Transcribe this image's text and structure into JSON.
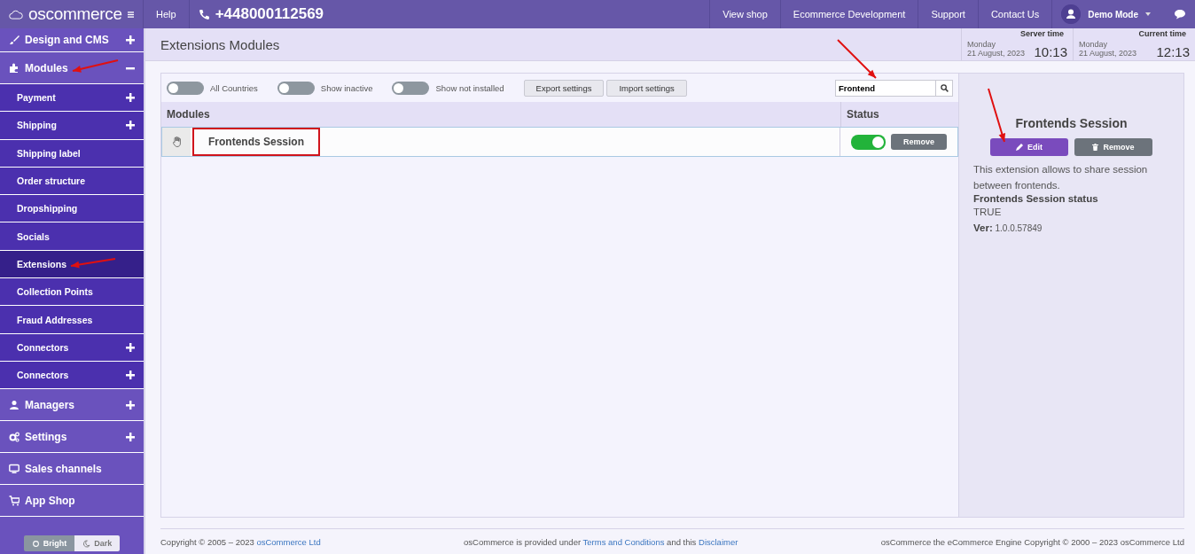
{
  "topbar": {
    "brand": "oscommerce",
    "help": "Help",
    "phone": "+448000112569",
    "links": [
      {
        "label": "View shop"
      },
      {
        "label": "Ecommerce Development"
      },
      {
        "label": "Support"
      },
      {
        "label": "Contact Us"
      }
    ],
    "user": "Demo Mode"
  },
  "sidebar": {
    "items": [
      {
        "kind": "section",
        "label": "Design and CMS",
        "expanded": false,
        "selected": false
      },
      {
        "kind": "section",
        "label": "Modules",
        "expanded": true,
        "selected": false
      },
      {
        "kind": "subitem",
        "label": "Payment",
        "expanded": false,
        "selected": false
      },
      {
        "kind": "subitem",
        "label": "Shipping",
        "expanded": false,
        "selected": false
      },
      {
        "kind": "subitem",
        "label": "Shipping label",
        "selected": false
      },
      {
        "kind": "subitem",
        "label": "Order structure",
        "selected": false
      },
      {
        "kind": "subitem",
        "label": "Dropshipping",
        "selected": false
      },
      {
        "kind": "subitem",
        "label": "Socials",
        "selected": false
      },
      {
        "kind": "subitem",
        "label": "Extensions",
        "selected": true
      },
      {
        "kind": "subitem",
        "label": "Collection Points",
        "selected": false
      },
      {
        "kind": "subitem",
        "label": "Fraud Addresses",
        "selected": false
      },
      {
        "kind": "subitem",
        "label": "Connectors",
        "expanded": false,
        "selected": false
      },
      {
        "kind": "subitem",
        "label": "Connectors",
        "expanded": false,
        "selected": false
      },
      {
        "kind": "section",
        "label": "Managers",
        "expanded": false,
        "selected": false
      },
      {
        "kind": "section",
        "label": "Settings",
        "expanded": false,
        "selected": false
      },
      {
        "kind": "section",
        "label": "Sales channels",
        "selected": false
      },
      {
        "kind": "section",
        "label": "App Shop",
        "selected": false
      }
    ],
    "theme": [
      {
        "kind": "sun",
        "label": "Bright",
        "selected": true
      },
      {
        "kind": "moon",
        "label": "Dark",
        "selected": false
      }
    ]
  },
  "page": {
    "title": "Extensions Modules",
    "clocks": [
      {
        "label": "Server time",
        "day": "Monday",
        "date": "21 August, 2023",
        "time": "10:13"
      },
      {
        "label": "Current time",
        "day": "Monday",
        "date": "21 August, 2023",
        "time": "12:13"
      }
    ]
  },
  "filters": [
    {
      "label": "All Countries",
      "on": false
    },
    {
      "label": "Show inactive",
      "on": false
    },
    {
      "label": "Show not installed",
      "on": false
    }
  ],
  "actions": [
    "Export settings",
    "Import settings"
  ],
  "search": {
    "value": "Frontend"
  },
  "table": {
    "columns": [
      "Modules",
      "Status"
    ],
    "rows": [
      {
        "name": "Frontends Session",
        "on": true,
        "action": "Remove",
        "annotated": true
      }
    ]
  },
  "details": {
    "title": "Frontends Session",
    "edit": "Edit",
    "remove": "Remove",
    "description": "This extension allows to share session between frontends.",
    "status_label": "Frontends Session status",
    "status_value": "TRUE",
    "version": "**Ver:** 1.0.0.57849"
  },
  "footer": [
    [
      {
        "kind": "text",
        "text": "Copyright © 2005 – 2023 "
      },
      {
        "kind": "link",
        "text": "osCommerce Ltd"
      }
    ],
    [
      {
        "kind": "text",
        "text": "osCommerce is provided under "
      },
      {
        "kind": "link",
        "text": "Terms and Conditions"
      },
      {
        "kind": "text",
        "text": " and this "
      },
      {
        "kind": "link",
        "text": "Disclaimer"
      }
    ],
    [
      {
        "kind": "text",
        "text": "osCommerce the eCommerce Engine Copyright © 2000 – 2023 osCommerce Ltd"
      }
    ]
  ]
}
